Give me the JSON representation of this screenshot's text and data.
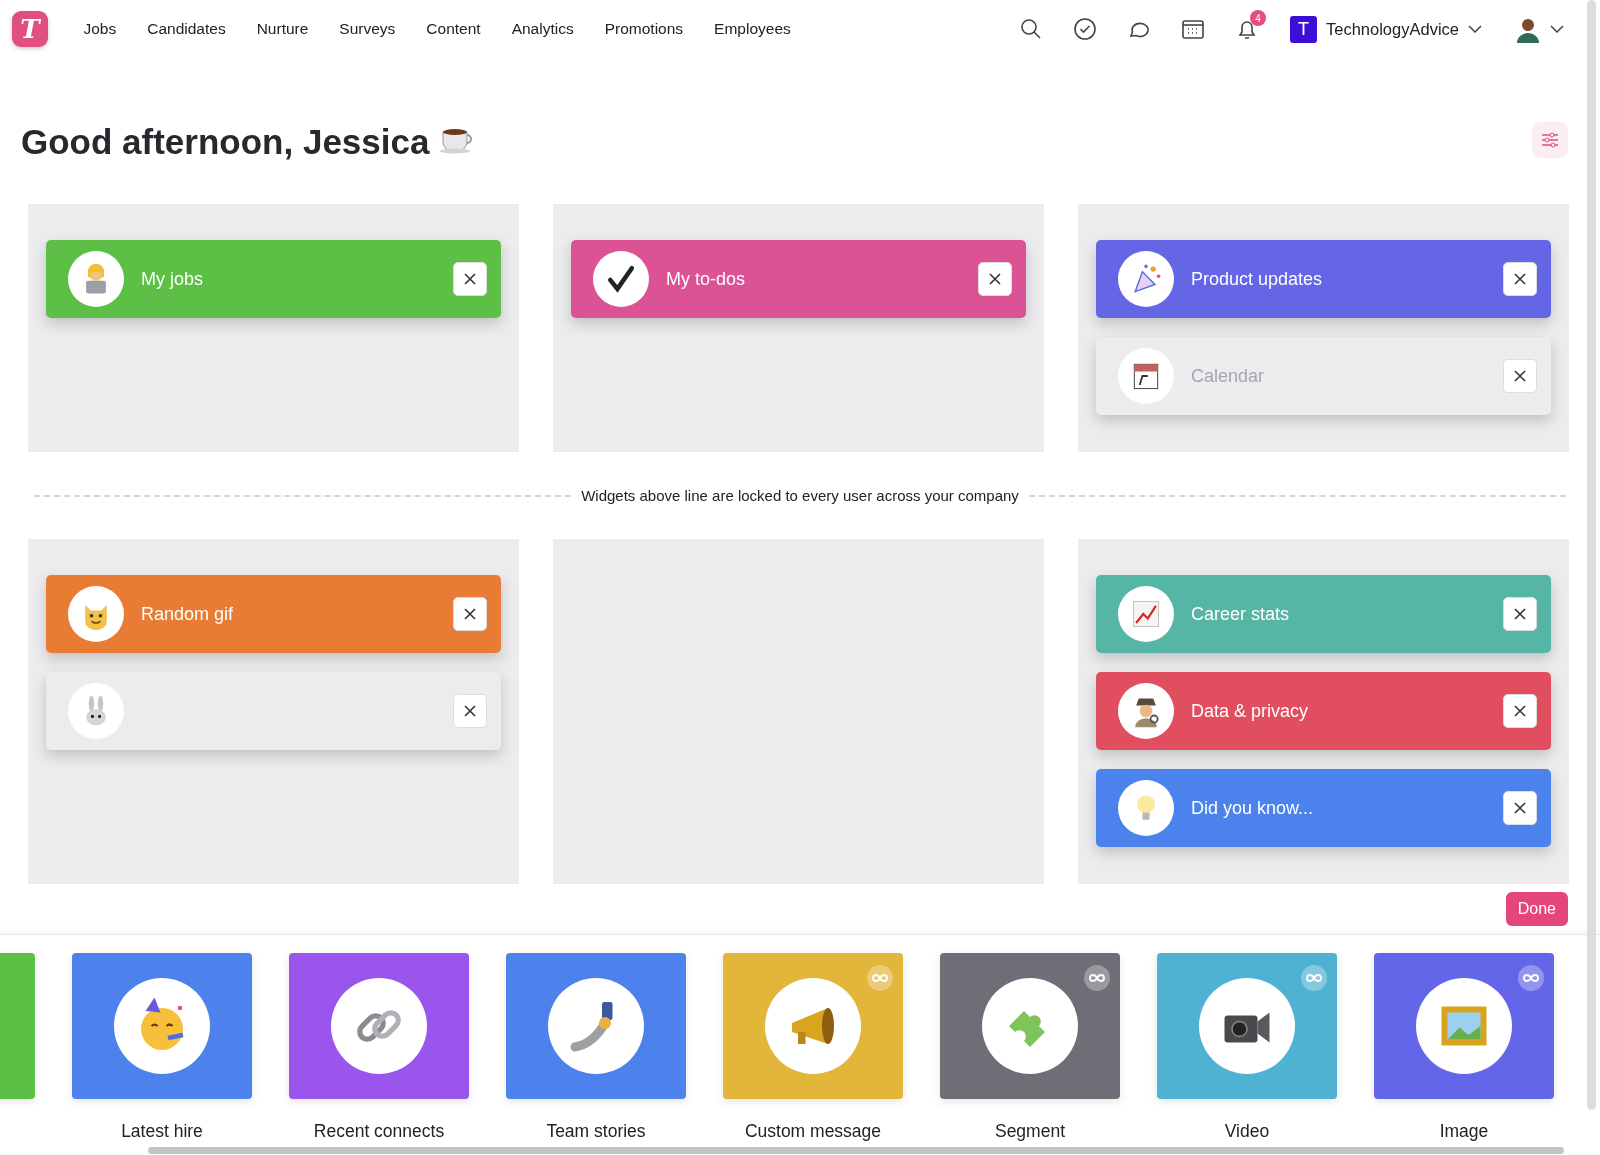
{
  "nav": {
    "logo": "T",
    "items": [
      {
        "label": "Jobs"
      },
      {
        "label": "Candidates"
      },
      {
        "label": "Nurture"
      },
      {
        "label": "Surveys"
      },
      {
        "label": "Content"
      },
      {
        "label": "Analytics"
      },
      {
        "label": "Promotions"
      },
      {
        "label": "Employees"
      }
    ],
    "notifications": "4",
    "org": {
      "initial": "T",
      "name": "TechnologyAdvice"
    }
  },
  "greeting": "Good afternoon, Jessica",
  "locked_columns": [
    [
      {
        "title": "My jobs",
        "color": "#5dbf46",
        "kind": "laptop-person",
        "active": true
      }
    ],
    [
      {
        "title": "My to-dos",
        "color": "#db5295",
        "kind": "check",
        "active": true
      }
    ],
    [
      {
        "title": "Product updates",
        "color": "#6566e6",
        "kind": "party",
        "active": true
      },
      {
        "title": "Calendar",
        "kind": "calendar",
        "active": false
      }
    ]
  ],
  "divider": "Widgets above line are locked to every user across your company",
  "free_columns": [
    [
      {
        "title": "Random gif",
        "color": "#e97c35",
        "kind": "cat",
        "active": true
      },
      {
        "kind": "rabbit",
        "active": false
      }
    ],
    [],
    [
      {
        "title": "Career stats",
        "color": "#56b6a6",
        "kind": "chart",
        "active": true
      },
      {
        "title": "Data & privacy",
        "color": "#e04e5f",
        "kind": "detective",
        "active": true
      },
      {
        "title": "Did you know...",
        "color": "#4b82ec",
        "kind": "bulb",
        "active": true
      }
    ]
  ],
  "done": "Done",
  "tray": [
    {
      "color": "#5dbf46",
      "kind": "partial",
      "unlimited": false
    },
    {
      "label": "Latest hire",
      "color": "#4d82ec",
      "kind": "party-face",
      "unlimited": false
    },
    {
      "label": "Recent connects",
      "color": "#9a55ec",
      "kind": "link",
      "unlimited": false
    },
    {
      "label": "Team stories",
      "color": "#4d82ec",
      "kind": "selfie",
      "unlimited": false
    },
    {
      "label": "Custom message",
      "color": "#e2b53b",
      "kind": "megaphone",
      "unlimited": true
    },
    {
      "label": "Segment",
      "color": "#6e6e76",
      "kind": "puzzle",
      "unlimited": true
    },
    {
      "label": "Video",
      "color": "#4fb2d2",
      "kind": "camera",
      "unlimited": true
    },
    {
      "label": "Image",
      "color": "#6466e9",
      "kind": "frame",
      "unlimited": true
    }
  ]
}
